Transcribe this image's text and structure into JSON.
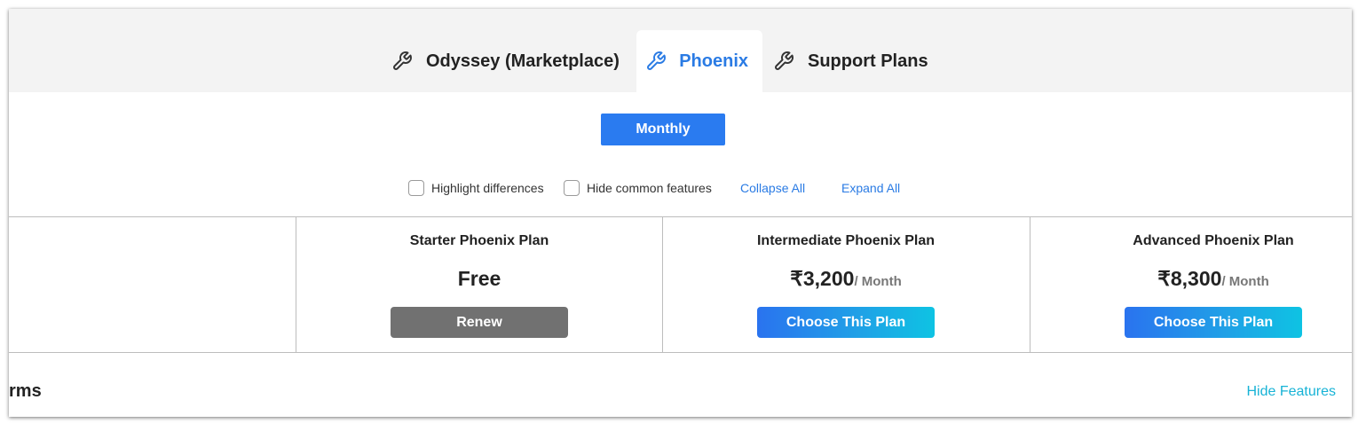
{
  "tabs": [
    {
      "label": "Odyssey (Marketplace)",
      "icon": "wrench-icon",
      "active": false
    },
    {
      "label": "Phoenix",
      "icon": "wrench-icon",
      "active": true
    },
    {
      "label": "Support Plans",
      "icon": "wrench-icon",
      "active": false
    }
  ],
  "billing": {
    "selected": "Monthly"
  },
  "options": {
    "highlight_label": "Highlight differences",
    "hide_label": "Hide common features",
    "collapse_label": "Collapse All",
    "expand_label": "Expand All"
  },
  "plans": [
    {
      "name": "Starter Phoenix Plan",
      "price": "Free",
      "per": "",
      "button": "Renew"
    },
    {
      "name": "Intermediate Phoenix Plan",
      "price": "₹3,200",
      "per": "/ Month",
      "button": "Choose This Plan"
    },
    {
      "name": "Advanced Phoenix Plan",
      "price": "₹8,300",
      "per": "/ Month",
      "button": "Choose This Plan"
    }
  ],
  "section": {
    "title": "rms",
    "toggle_label": "Hide Features"
  },
  "colors": {
    "accent": "#2a7be4",
    "tab_bg": "#f3f3f3",
    "renew_button": "#717171",
    "gradient_start": "#2a73ef",
    "gradient_end": "#0ec3e3",
    "hide_features_link": "#17b3d6"
  }
}
